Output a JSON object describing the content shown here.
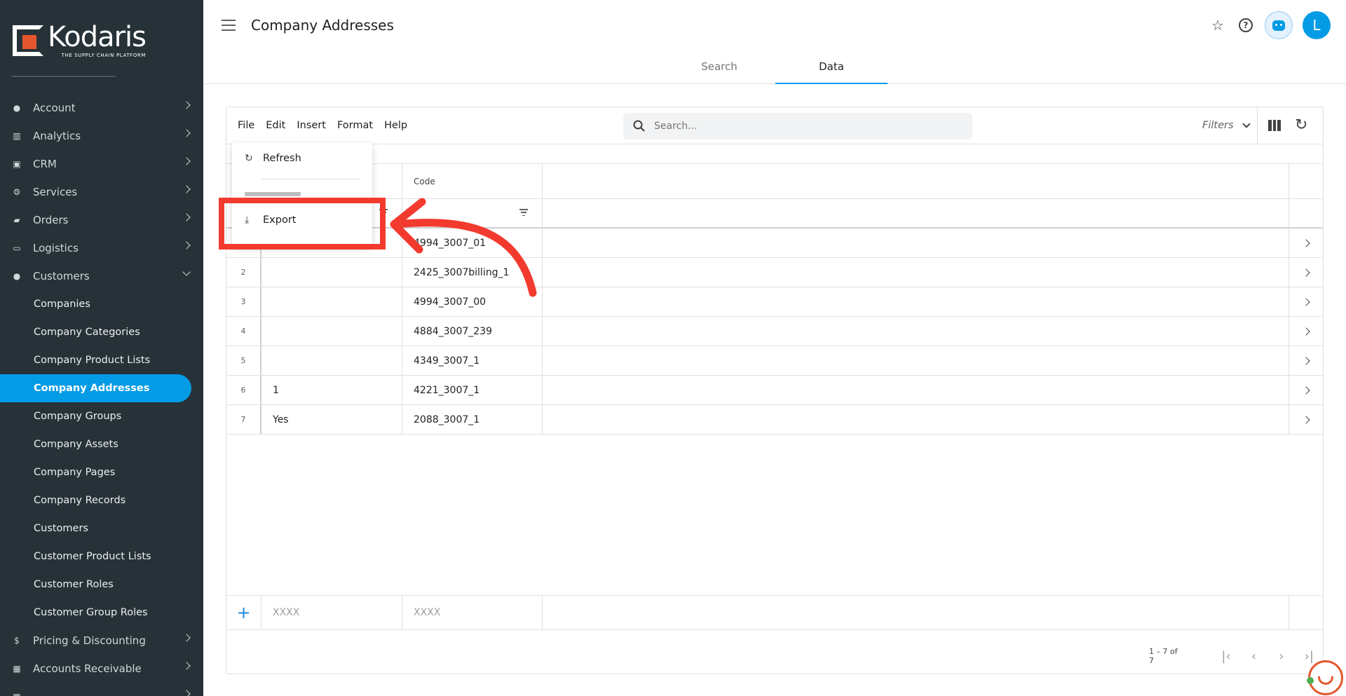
{
  "app": {
    "logo_name": "Kodaris",
    "logo_tagline": "THE SUPPLY CHAIN PLATFORM"
  },
  "header": {
    "title": "Company Addresses",
    "avatar_initial": "L"
  },
  "tabs": [
    {
      "label": "Search",
      "active": false
    },
    {
      "label": "Data",
      "active": true
    }
  ],
  "sidebar": {
    "items": [
      {
        "label": "Account",
        "icon": "person-icon",
        "expanded": false
      },
      {
        "label": "Analytics",
        "icon": "analytics-icon",
        "expanded": false
      },
      {
        "label": "CRM",
        "icon": "contact-card-icon",
        "expanded": false
      },
      {
        "label": "Services",
        "icon": "gears-icon",
        "expanded": false
      },
      {
        "label": "Orders",
        "icon": "truck-icon",
        "expanded": false
      },
      {
        "label": "Logistics",
        "icon": "delivery-icon",
        "expanded": false
      },
      {
        "label": "Customers",
        "icon": "people-icon",
        "expanded": true
      }
    ],
    "sub_items": [
      {
        "label": "Companies",
        "active": false
      },
      {
        "label": "Company Categories",
        "active": false
      },
      {
        "label": "Company Product Lists",
        "active": false
      },
      {
        "label": "Company Addresses",
        "active": true
      },
      {
        "label": "Company Groups",
        "active": false
      },
      {
        "label": "Company Assets",
        "active": false
      },
      {
        "label": "Company Pages",
        "active": false
      },
      {
        "label": "Company Records",
        "active": false
      },
      {
        "label": "Customers",
        "active": false
      },
      {
        "label": "Customer Product Lists",
        "active": false
      },
      {
        "label": "Customer Roles",
        "active": false
      },
      {
        "label": "Customer Group Roles",
        "active": false
      }
    ],
    "bottom_items": [
      {
        "label": "Pricing & Discounting",
        "icon": "dollar-icon"
      },
      {
        "label": "Accounts Receivable",
        "icon": "bank-icon"
      }
    ]
  },
  "toolbar": {
    "menus": [
      "File",
      "Edit",
      "Insert",
      "Format",
      "Help"
    ],
    "search_placeholder": "Search...",
    "filters_label": "Filters"
  },
  "dropdown": {
    "refresh_label": "Refresh",
    "export_label": "Export"
  },
  "grid": {
    "columns": [
      "",
      "Code"
    ],
    "rows": [
      {
        "num": "1",
        "col1": "",
        "code": "4994_3007_01"
      },
      {
        "num": "2",
        "col1": "",
        "code": "2425_3007billing_1"
      },
      {
        "num": "3",
        "col1": "",
        "code": "4994_3007_00"
      },
      {
        "num": "4",
        "col1": "",
        "code": "4884_3007_239"
      },
      {
        "num": "5",
        "col1": "",
        "code": "4349_3007_1"
      },
      {
        "num": "6",
        "col1": "1",
        "code": "4221_3007_1"
      },
      {
        "num": "7",
        "col1": "Yes",
        "code": "2088_3007_1"
      }
    ],
    "new_row_placeholder_1": "XXXX",
    "new_row_placeholder_2": "XXXX"
  },
  "pager": {
    "range_text": "1 – 7 of 7"
  },
  "colors": {
    "accent": "#039be5",
    "sidebar_bg": "#263238",
    "annotation": "#f33a2f",
    "brand": "#e4572e"
  }
}
